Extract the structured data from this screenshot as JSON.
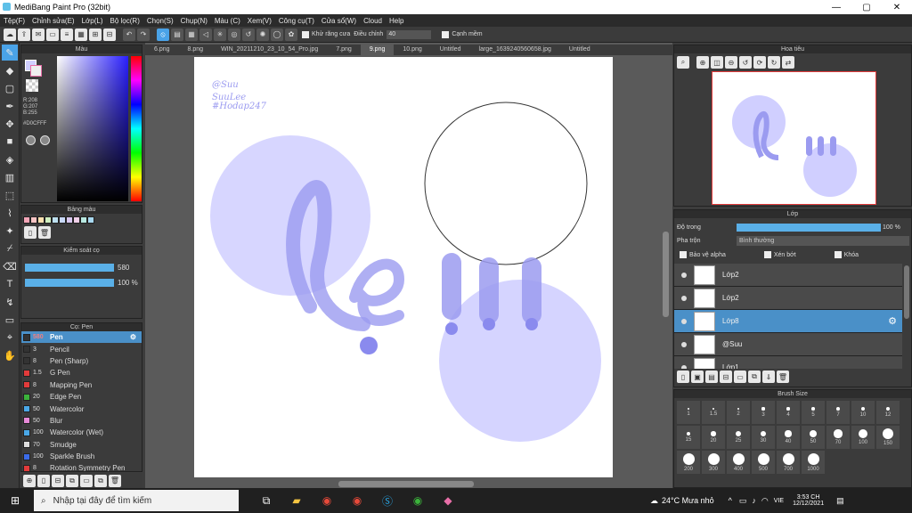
{
  "app": {
    "title": "MediBang Paint Pro (32bit)"
  },
  "menu": [
    "Tệp(F)",
    "Chỉnh sửa(E)",
    "Lớp(L)",
    "Bộ lọc(R)",
    "Chọn(S)",
    "Chụp(N)",
    "Màu (C)",
    "Xem(V)",
    "Công cụ(T)",
    "Cửa sổ(W)",
    "Cloud",
    "Help"
  ],
  "toolbar": {
    "antialias_label": "Khử răng cưa",
    "adjust_label": "Điều chỉnh",
    "adjust_value": "40",
    "soft_edge_label": "Cạnh mềm"
  },
  "tabs": [
    "6.png",
    "8.png",
    "WIN_20211210_23_10_54_Pro.jpg",
    "7.png",
    "9.png",
    "10.png",
    "Untitled",
    "large_1639240560658.jpg",
    "Untitled"
  ],
  "active_tab_index": 4,
  "color_panel": {
    "title": "Màu",
    "r": "R:208",
    "g": "G:207",
    "b": "B:255",
    "hex": "#D0CFFF",
    "fg_color": "#d0cfff"
  },
  "palette": {
    "title": "Bảng màu",
    "swatches": [
      "#f4a6b8",
      "#f7c4c4",
      "#fbe0b0",
      "#d0efc0",
      "#bde0f0",
      "#c8d8f8",
      "#d8c8f0",
      "#f0d0e8",
      "#b8e8e0",
      "#a8d8f0"
    ]
  },
  "brush_control": {
    "title": "Kiểm soát cọ",
    "size": "580",
    "opacity": "100 %"
  },
  "brush_panel": {
    "title": "Cọ: Pen",
    "items": [
      {
        "size": "580",
        "name": "Pen",
        "color": "#333"
      },
      {
        "size": "3",
        "name": "Pencil",
        "color": "#333"
      },
      {
        "size": "8",
        "name": "Pen (Sharp)",
        "color": "#333"
      },
      {
        "size": "1.5",
        "name": "G Pen",
        "color": "#e23b3b"
      },
      {
        "size": "8",
        "name": "Mapping Pen",
        "color": "#e23b3b"
      },
      {
        "size": "20",
        "name": "Edge Pen",
        "color": "#3bb33b"
      },
      {
        "size": "50",
        "name": "Watercolor",
        "color": "#4aa8e8"
      },
      {
        "size": "50",
        "name": "Blur",
        "color": "#e88ad8"
      },
      {
        "size": "100",
        "name": "Watercolor (Wet)",
        "color": "#4aa8e8"
      },
      {
        "size": "70",
        "name": "Smudge",
        "color": "#ddd"
      },
      {
        "size": "100",
        "name": "Sparkle Brush",
        "color": "#3b6be8"
      },
      {
        "size": "8",
        "name": "Rotation Symmetry Pen",
        "color": "#e23b3b"
      }
    ]
  },
  "canvas": {
    "signature_lines": [
      "@Suu",
      "SuuLee",
      "#Hodap247"
    ]
  },
  "navigator": {
    "title": "Hoa tiêu"
  },
  "layers_panel": {
    "title": "Lớp",
    "opacity_label": "Độ trong",
    "opacity_value": "100 %",
    "opacity_fraction": 1.0,
    "blend_label": "Pha trộn",
    "blend_value": "Bình thường",
    "protect_alpha": "Bảo vệ alpha",
    "clipping": "Xén bớt",
    "lock": "Khóa",
    "layers": [
      {
        "name": "Lớp2",
        "active": false
      },
      {
        "name": "Lớp2",
        "active": false
      },
      {
        "name": "Lớp8",
        "active": true
      },
      {
        "name": "@Suu",
        "active": false
      },
      {
        "name": "Lớp1",
        "active": false
      }
    ]
  },
  "brush_size": {
    "title": "Brush Size",
    "sizes": [
      "1",
      "1.5",
      "2",
      "3",
      "4",
      "5",
      "7",
      "10",
      "12",
      "15",
      "20",
      "25",
      "30",
      "40",
      "50",
      "70",
      "100",
      "150",
      "200",
      "300",
      "400",
      "500",
      "700",
      "1000"
    ]
  },
  "taskbar": {
    "search_placeholder": "Nhập tại đây để tìm kiếm",
    "weather": "24°C Mưa nhỏ",
    "lang": "VIE",
    "time": "3:53 CH",
    "date": "12/12/2021"
  }
}
